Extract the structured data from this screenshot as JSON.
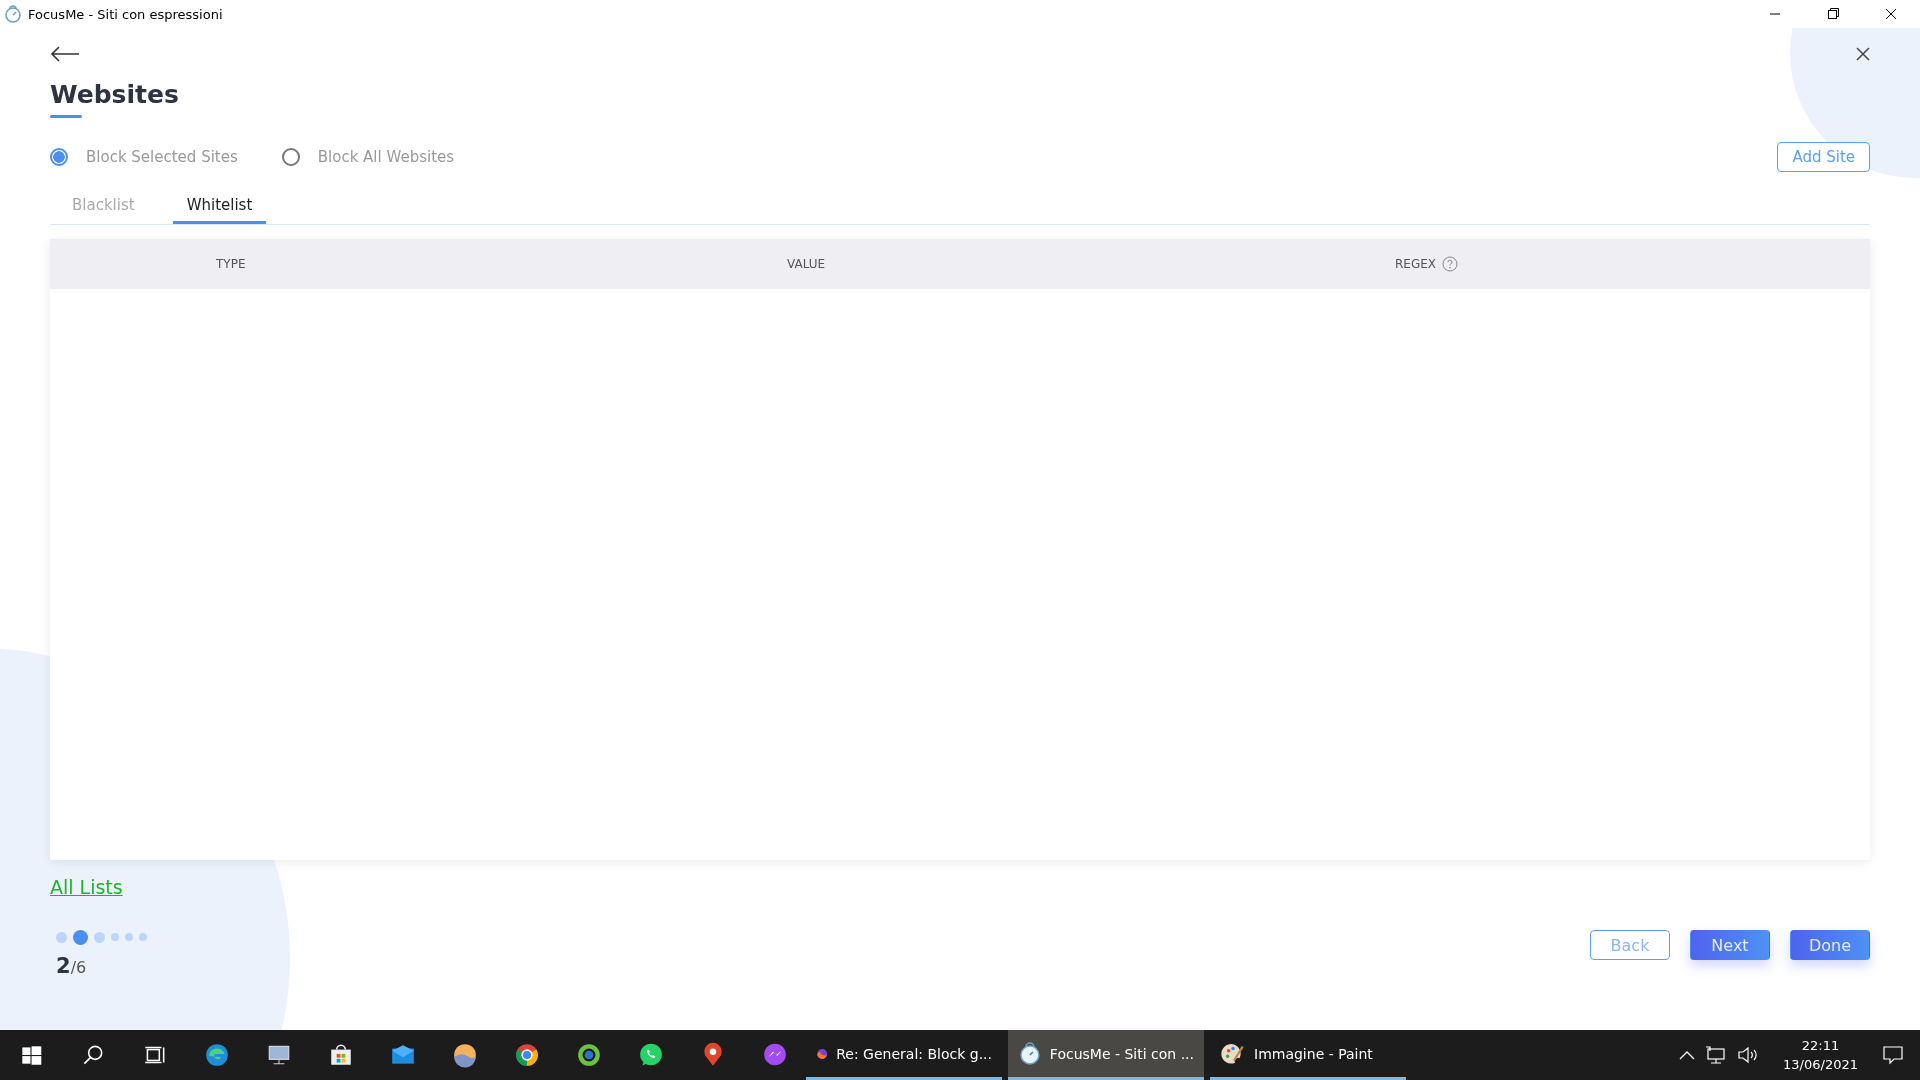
{
  "window": {
    "title": "FocusMe - Siti con espressioni"
  },
  "page": {
    "title": "Websites",
    "modes": [
      {
        "label": "Block Selected Sites",
        "selected": true
      },
      {
        "label": "Block All Websites",
        "selected": false
      }
    ],
    "add_button": "Add Site",
    "tabs": [
      {
        "label": "Blacklist",
        "selected": false
      },
      {
        "label": "Whitelist",
        "selected": true
      }
    ],
    "table": {
      "columns": [
        "TYPE",
        "VALUE",
        "REGEX"
      ]
    },
    "link": "All Lists",
    "steps": [
      {
        "selected": false
      },
      {
        "selected": true
      },
      {
        "selected": false
      },
      {
        "selected": false
      },
      {
        "selected": false
      },
      {
        "selected": false
      }
    ],
    "step_current": "2",
    "step_total": "/6",
    "buttons": [
      {
        "label": "Back",
        "kind": "outline"
      },
      {
        "label": "Next",
        "kind": "primary"
      },
      {
        "label": "Done",
        "kind": "primary"
      }
    ]
  },
  "taskbar": {
    "windows": [
      {
        "label": "Re: General: Block g...",
        "selected": false
      },
      {
        "label": "FocusMe - Siti con ...",
        "selected": true
      },
      {
        "label": "Immagine - Paint",
        "selected": false
      }
    ],
    "time": "22:11",
    "date": "13/06/2021"
  }
}
